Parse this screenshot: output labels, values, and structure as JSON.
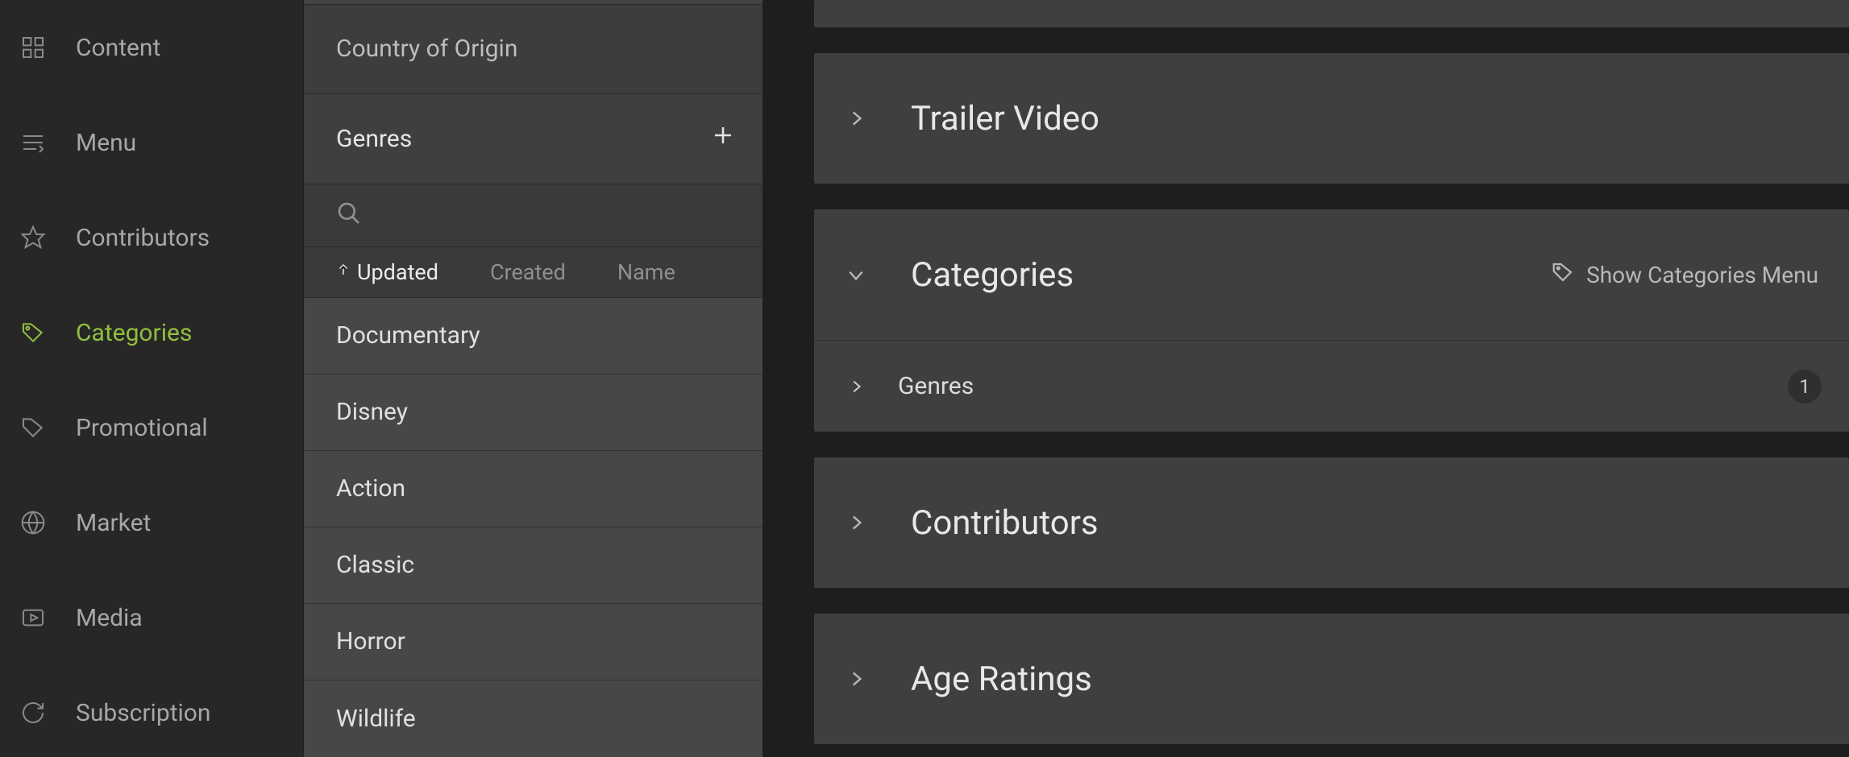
{
  "nav": {
    "items": [
      {
        "icon": "grid-icon",
        "label": "Content"
      },
      {
        "icon": "menu-icon",
        "label": "Menu"
      },
      {
        "icon": "star-icon",
        "label": "Contributors"
      },
      {
        "icon": "tag-icon",
        "label": "Categories"
      },
      {
        "icon": "tag2-icon",
        "label": "Promotional"
      },
      {
        "icon": "globe-icon",
        "label": "Market"
      },
      {
        "icon": "play-icon",
        "label": "Media"
      },
      {
        "icon": "refresh-icon",
        "label": "Subscription"
      }
    ],
    "active_index": 3
  },
  "sidepanel": {
    "country_label": "Country of Origin",
    "genres_label": "Genres",
    "sort": {
      "columns": [
        "Updated",
        "Created",
        "Name"
      ],
      "active_index": 0
    },
    "items": [
      "Documentary",
      "Disney",
      "Action",
      "Classic",
      "Horror",
      "Wildlife"
    ]
  },
  "main": {
    "panels": [
      {
        "title": "Trailer Video",
        "expanded": false
      },
      {
        "title": "Categories",
        "expanded": true,
        "action_label": "Show Categories Menu",
        "subrows": [
          {
            "title": "Genres",
            "count": "1"
          }
        ]
      },
      {
        "title": "Contributors",
        "expanded": false
      },
      {
        "title": "Age Ratings",
        "expanded": false
      }
    ]
  }
}
